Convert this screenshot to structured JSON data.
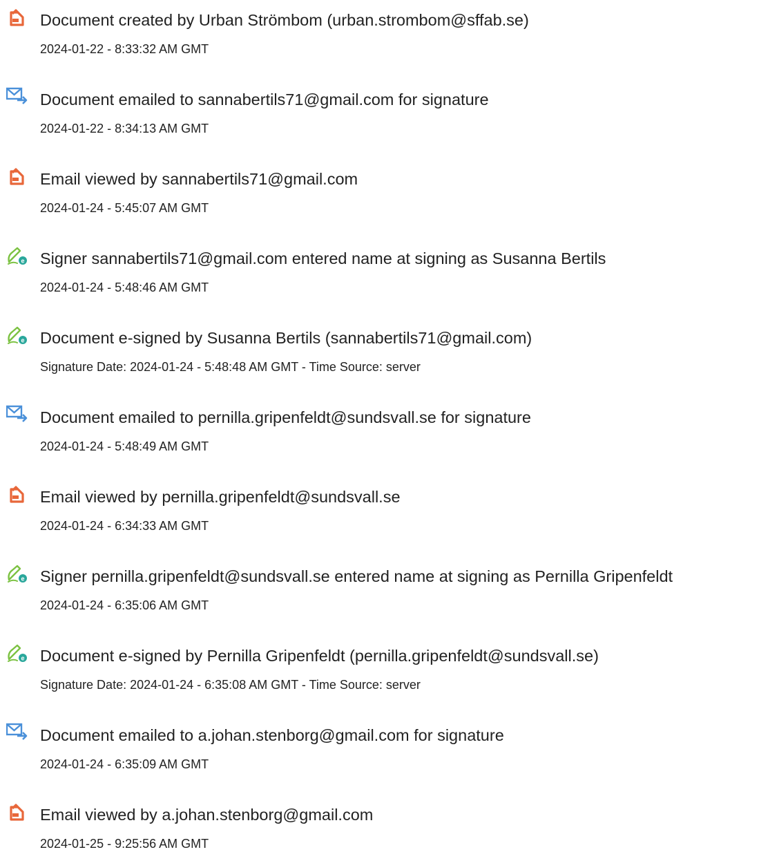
{
  "events": [
    {
      "icon": "document-created-icon",
      "title": "Document created by Urban Strömbom (urban.strombom@sffab.se)",
      "date": "2024-01-22 - 8:33:32 AM GMT"
    },
    {
      "icon": "email-sent-icon",
      "title": "Document emailed to sannabertils71@gmail.com for signature",
      "date": "2024-01-22 - 8:34:13 AM GMT"
    },
    {
      "icon": "document-viewed-icon",
      "title": "Email viewed by sannabertils71@gmail.com",
      "date": "2024-01-24 - 5:45:07 AM GMT"
    },
    {
      "icon": "e-sign-icon",
      "title": "Signer sannabertils71@gmail.com entered name at signing as Susanna Bertils",
      "date": "2024-01-24 - 5:48:46 AM GMT"
    },
    {
      "icon": "e-sign-icon",
      "title": "Document e-signed by Susanna Bertils (sannabertils71@gmail.com)",
      "date": "Signature Date: 2024-01-24 - 5:48:48 AM GMT - Time Source: server"
    },
    {
      "icon": "email-sent-icon",
      "title": "Document emailed to pernilla.gripenfeldt@sundsvall.se for signature",
      "date": "2024-01-24 - 5:48:49 AM GMT"
    },
    {
      "icon": "document-viewed-icon",
      "title": "Email viewed by pernilla.gripenfeldt@sundsvall.se",
      "date": "2024-01-24 - 6:34:33 AM GMT"
    },
    {
      "icon": "e-sign-icon",
      "title": "Signer pernilla.gripenfeldt@sundsvall.se entered name at signing as Pernilla Gripenfeldt",
      "date": "2024-01-24 - 6:35:06 AM GMT"
    },
    {
      "icon": "e-sign-icon",
      "title": "Document e-signed by Pernilla Gripenfeldt (pernilla.gripenfeldt@sundsvall.se)",
      "date": "Signature Date: 2024-01-24 - 6:35:08 AM GMT - Time Source: server"
    },
    {
      "icon": "email-sent-icon",
      "title": "Document emailed to a.johan.stenborg@gmail.com for signature",
      "date": "2024-01-24 - 6:35:09 AM GMT"
    },
    {
      "icon": "document-viewed-icon",
      "title": "Email viewed by a.johan.stenborg@gmail.com",
      "date": "2024-01-25 - 9:25:56 AM GMT"
    }
  ],
  "colors": {
    "document_icon": "#E8673A",
    "email_icon": "#4A90D9",
    "sign_icon": "#7CC242",
    "sign_badge": "#2AA79B",
    "text": "#222222"
  }
}
